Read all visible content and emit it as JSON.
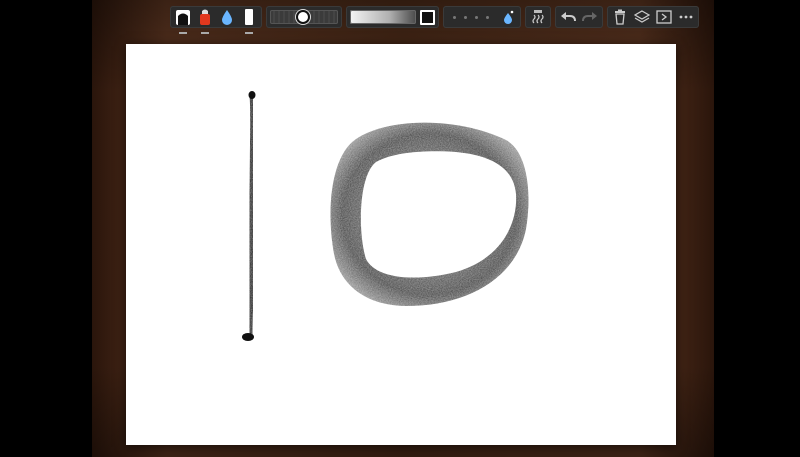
{
  "app": {
    "toolbar": {
      "brush_slider": {
        "level": 0.48
      },
      "opacity_slider": {
        "level": 0.95
      },
      "icons": {
        "ink": "ink-pot-icon",
        "color": "red-paint-icon",
        "water": "water-drop-icon",
        "paper": "paper-icon",
        "wet": "wet-brush-icon",
        "dry": "dry-texture-icon",
        "undo": "undo-icon",
        "redo": "redo-icon",
        "trash": "trash-icon",
        "layers": "layers-icon",
        "export": "export-icon",
        "more": "more-icon"
      },
      "colors": {
        "accent_red": "#e2381e",
        "accent_blue": "#6ab6ff",
        "toolbar_bg": "#2b2b2b"
      }
    },
    "canvas": {
      "background": "#ffffff",
      "strokes": [
        "vertical-line-stroke",
        "circle-stroke"
      ]
    }
  }
}
